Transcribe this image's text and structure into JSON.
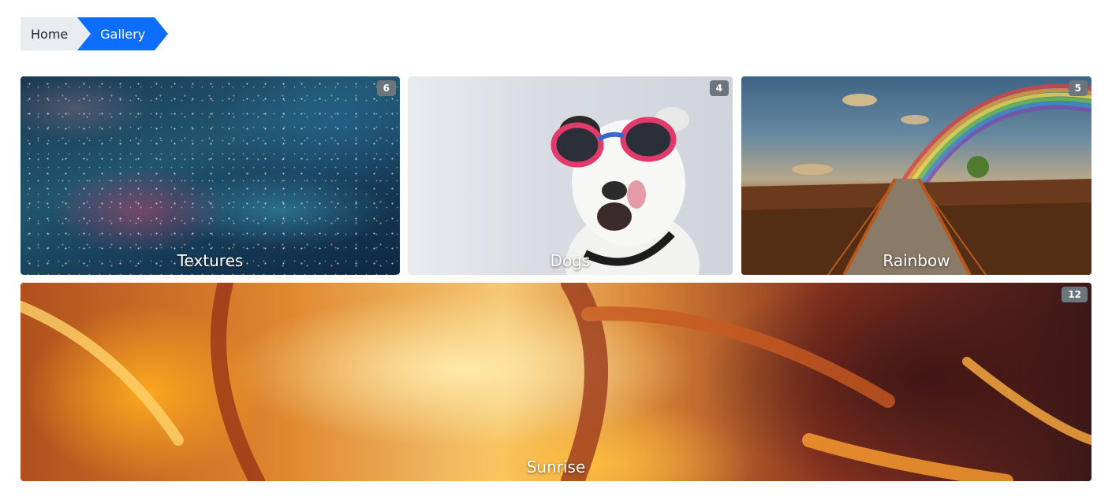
{
  "breadcrumb": {
    "home": "Home",
    "current": "Gallery"
  },
  "tiles": [
    {
      "label": "Textures",
      "count": "6"
    },
    {
      "label": "Dogs",
      "count": "4"
    },
    {
      "label": "Rainbow",
      "count": "5"
    },
    {
      "label": "Sunrise",
      "count": "12"
    }
  ],
  "colors": {
    "breadcrumb_home_bg": "#e9ecef",
    "breadcrumb_active_bg": "#0d6efd",
    "badge_bg": "#6c757d"
  }
}
